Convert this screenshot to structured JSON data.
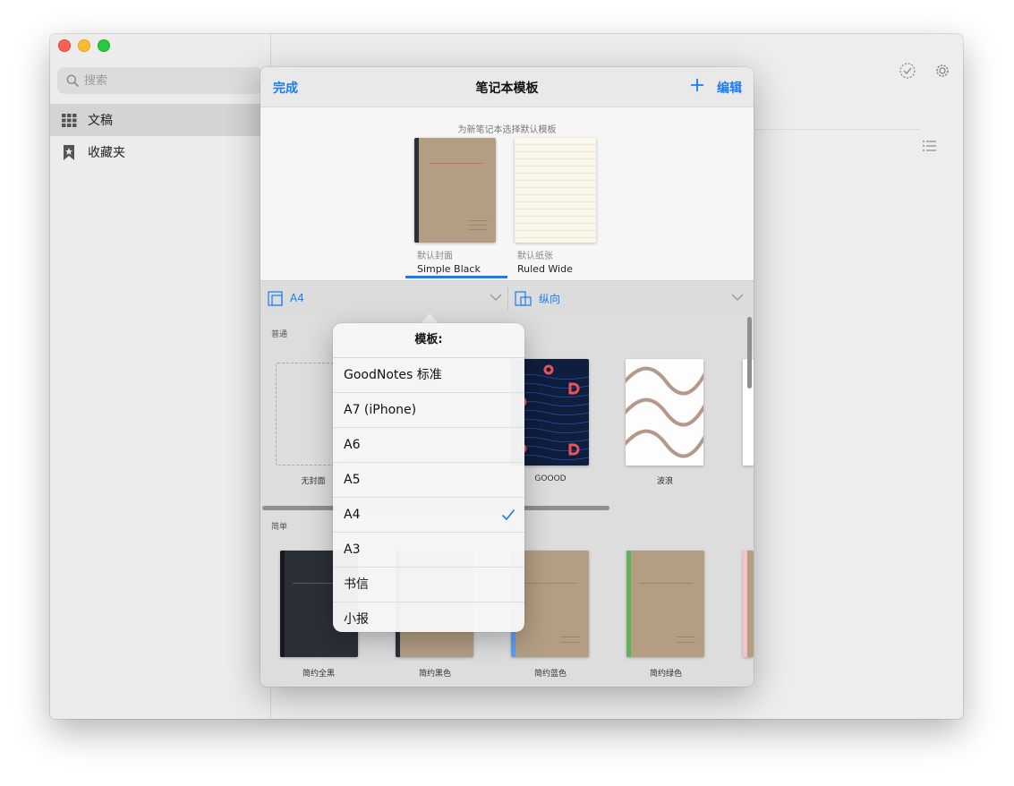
{
  "sidebar": {
    "search_placeholder": "搜索",
    "items": [
      {
        "label": "文稿",
        "icon": "grid-icon",
        "active": true
      },
      {
        "label": "收藏夹",
        "icon": "bookmark-star-icon",
        "active": false
      }
    ]
  },
  "toolbar": {
    "icons": [
      "checkmark-circle-icon",
      "gear-icon",
      "list-icon"
    ]
  },
  "popover": {
    "done_label": "完成",
    "title": "笔记本模板",
    "edit_label": "编辑",
    "hint": "为新笔记本选择默认模板",
    "defaults": [
      {
        "caption": "默认封面",
        "name": "Simple Black"
      },
      {
        "caption": "默认纸张",
        "name": "Ruled Wide"
      }
    ],
    "size_label": "A4",
    "orientation_label": "纵向"
  },
  "sections": [
    {
      "label": "普通",
      "items": [
        "无封面",
        "GOOOD",
        "波浪"
      ]
    },
    {
      "label": "简单",
      "items": [
        "简约全黑",
        "简约黑色",
        "简约蓝色",
        "简约绿色"
      ]
    }
  ],
  "menu": {
    "title": "模板:",
    "items": [
      {
        "label": "GoodNotes 标准",
        "selected": false
      },
      {
        "label": "A7 (iPhone)",
        "selected": false
      },
      {
        "label": "A6",
        "selected": false
      },
      {
        "label": "A5",
        "selected": false
      },
      {
        "label": "A4",
        "selected": true
      },
      {
        "label": "A3",
        "selected": false
      },
      {
        "label": "书信",
        "selected": false
      },
      {
        "label": "小报",
        "selected": false
      }
    ]
  },
  "colors": {
    "accent": "#1a7cf0",
    "kraft": "#b39e84",
    "navy": "#0f1e3e",
    "coral": "#e8545a",
    "wave": "#b4988a",
    "stripe_blue": "#5b9df3",
    "stripe_green": "#5fb25b",
    "stripe_pink": "#f1c3c6",
    "black_cover": "#2b2f38"
  }
}
